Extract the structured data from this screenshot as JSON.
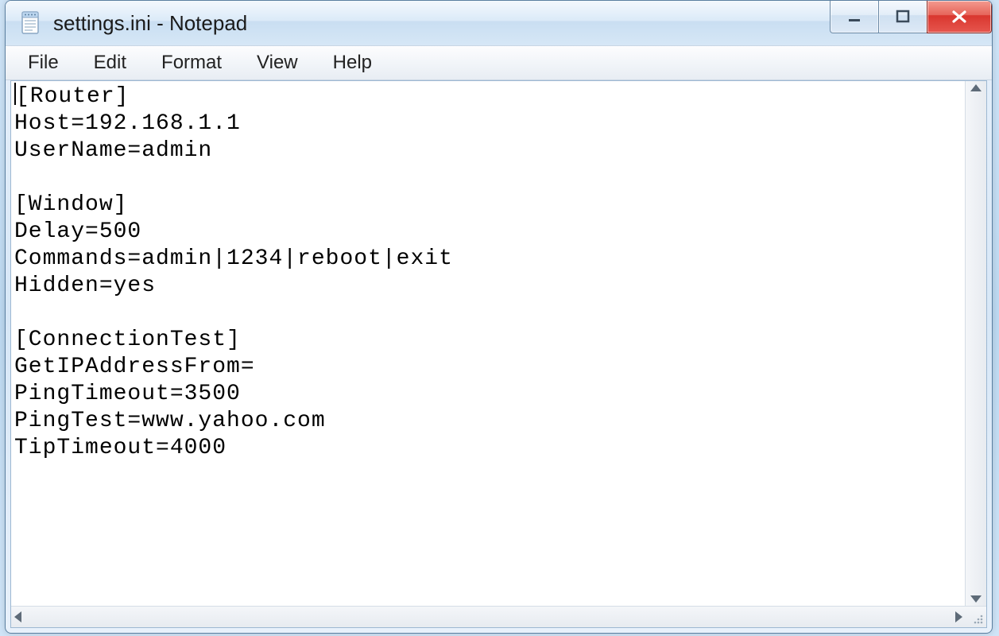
{
  "window": {
    "title": "settings.ini - Notepad"
  },
  "menu": {
    "file": "File",
    "edit": "Edit",
    "format": "Format",
    "view": "View",
    "help": "Help"
  },
  "document": {
    "lines": [
      "[Router]",
      "Host=192.168.1.1",
      "UserName=admin",
      "",
      "[Window]",
      "Delay=500",
      "Commands=admin|1234|reboot|exit",
      "Hidden=yes",
      "",
      "[ConnectionTest]",
      "GetIPAddressFrom=",
      "PingTimeout=3500",
      "PingTest=www.yahoo.com",
      "TipTimeout=4000"
    ]
  }
}
